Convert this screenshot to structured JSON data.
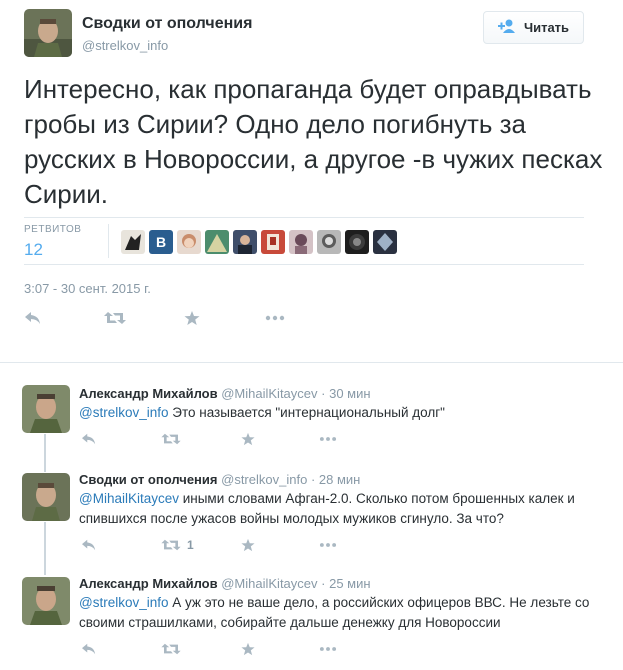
{
  "tweet": {
    "author_name": "Сводки от ополчения",
    "author_handle": "@strelkov_info",
    "follow_label": "Читать",
    "text": "Интересно, как пропаганда будет оправдывать гробы из Сирии? Одно дело погибнуть за русских в Новороссии, а другое -в чужих песках Сирии.",
    "retweets_label": "РЕТВИТОВ",
    "retweets_count": "12",
    "timestamp": "3:07 - 30 сент. 2015 г.",
    "retweeter_avatar_count": 10
  },
  "replies": [
    {
      "name": "Александр Михайлов",
      "handle": "@MihailKitaycev",
      "dot": "·",
      "time": "30 мин",
      "mention": "@strelkov_info",
      "text": " Это называется \"интернациональный долг\"",
      "retweet_count": ""
    },
    {
      "name": "Сводки от ополчения",
      "handle": "@strelkov_info",
      "dot": "·",
      "time": "28 мин",
      "mention": "@MihailKitaycev",
      "text": " иными словами Афган-2.0. Сколько потом брошенных калек и спившихся после ужасов войны молодых мужиков сгинуло. За что?",
      "retweet_count": "1"
    },
    {
      "name": "Александр Михайлов",
      "handle": "@MihailKitaycev",
      "dot": "·",
      "time": "25 мин",
      "mention": "@strelkov_info",
      "text": " А уж это не ваше дело, а российских офицеров ВВС. Не лезьте со своими страшилками, собирайте дальше денежку для Новороссии",
      "retweet_count": ""
    }
  ],
  "icons": [
    "reply-icon",
    "retweet-icon",
    "favorite-icon",
    "more-icon",
    "follow-person-icon"
  ],
  "colors": {
    "link": "#2b7bb9",
    "accent": "#55acee",
    "muted": "#8899a6",
    "icon": "#aab8c2"
  }
}
